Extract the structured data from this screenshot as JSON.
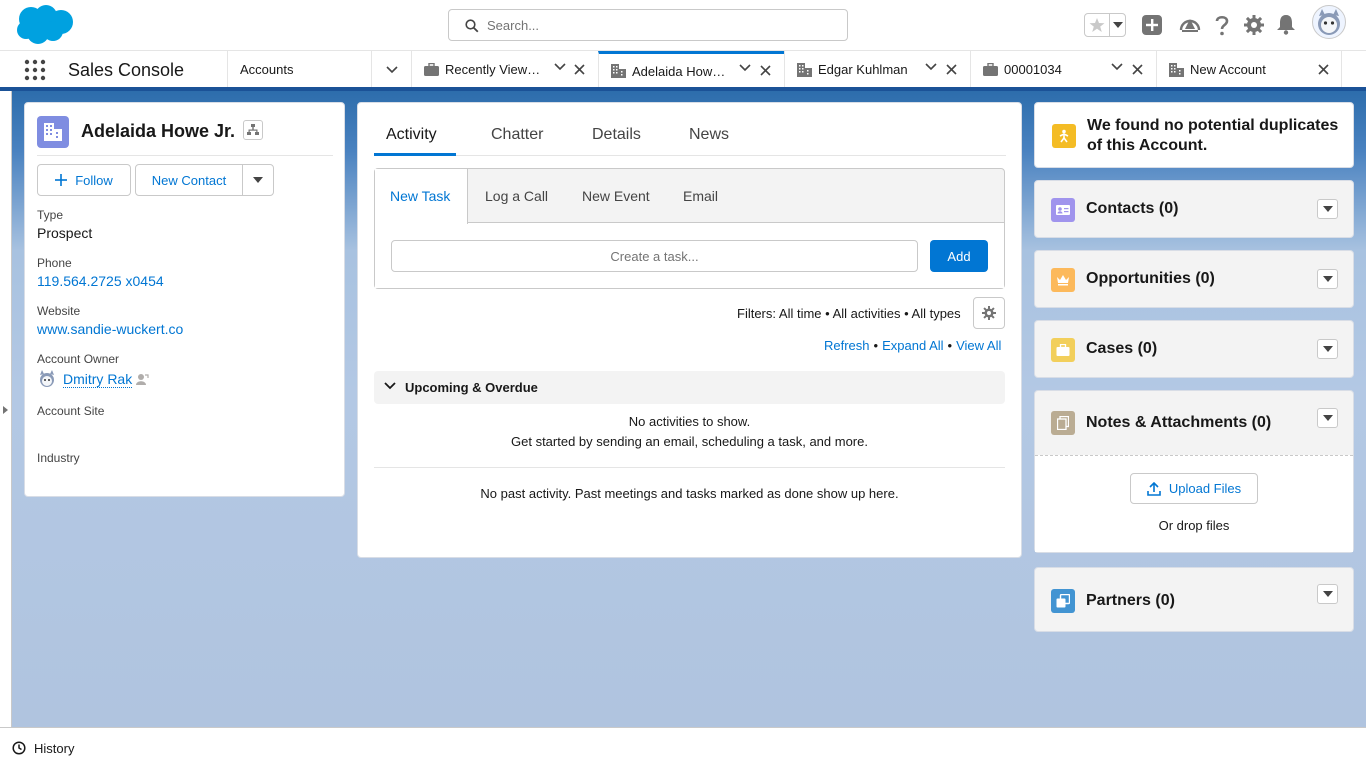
{
  "header": {
    "search_placeholder": "Search...",
    "icons": [
      "salesforce-logo",
      "search-icon",
      "star-icon",
      "add-icon",
      "trailhead-icon",
      "help-icon",
      "setup-gear-icon",
      "notifications-bell-icon",
      "user-avatar"
    ]
  },
  "nav": {
    "app_name": "Sales Console",
    "tabs": [
      {
        "label": "Accounts",
        "icon": "none"
      },
      {
        "label": "Recently View…",
        "icon": "briefcase-icon"
      },
      {
        "label": "Adelaida How…",
        "icon": "account-building-icon",
        "active": true
      },
      {
        "label": "Edgar Kuhlman",
        "icon": "account-building-icon"
      },
      {
        "label": "00001034",
        "icon": "briefcase-icon"
      },
      {
        "label": "New Account",
        "icon": "account-building-icon"
      }
    ]
  },
  "record": {
    "name": "Adelaida Howe Jr.",
    "follow_label": "Follow",
    "new_contact_label": "New Contact",
    "fields": {
      "type_label": "Type",
      "type_value": "Prospect",
      "phone_label": "Phone",
      "phone_value": "119.564.2725 x0454",
      "website_label": "Website",
      "website_value": "www.sandie-wuckert.co",
      "owner_label": "Account Owner",
      "owner_value": "Dmitry Rak",
      "site_label": "Account Site",
      "site_value": "",
      "industry_label": "Industry",
      "industry_value": ""
    }
  },
  "activity": {
    "tabs": [
      "Activity",
      "Chatter",
      "Details",
      "News"
    ],
    "composer_tabs": [
      "New Task",
      "Log a Call",
      "New Event",
      "Email"
    ],
    "task_placeholder": "Create a task...",
    "add_label": "Add",
    "filters_text": "Filters: All time • All activities • All types",
    "refresh_label": "Refresh",
    "expand_all_label": "Expand All",
    "view_all_label": "View All",
    "dot": "•",
    "upcoming_label": "Upcoming & Overdue",
    "no_activities": "No activities to show.",
    "get_started": "Get started by sending an email, scheduling a task, and more.",
    "no_past": "No past activity. Past meetings and tasks marked as done show up here."
  },
  "sidebar": {
    "duplicates_msg": "We found no potential duplicates of this Account.",
    "contacts_title": "Contacts (0)",
    "opportunities_title": "Opportunities (0)",
    "cases_title": "Cases (0)",
    "notes_title": "Notes & Attachments (0)",
    "upload_label": "Upload Files",
    "drop_label": "Or drop files",
    "partners_title": "Partners (0)"
  },
  "utility": {
    "history_label": "History"
  },
  "colors": {
    "brand_blue": "#0176d3",
    "account_icon": "#7f8de1",
    "contacts_icon": "#a094ed",
    "opportunities_icon": "#fcb95b",
    "cases_icon": "#f2cf5b",
    "notes_icon": "#baac93",
    "partners_icon": "#4294d2",
    "duplicates_icon": "#f4bc25"
  }
}
